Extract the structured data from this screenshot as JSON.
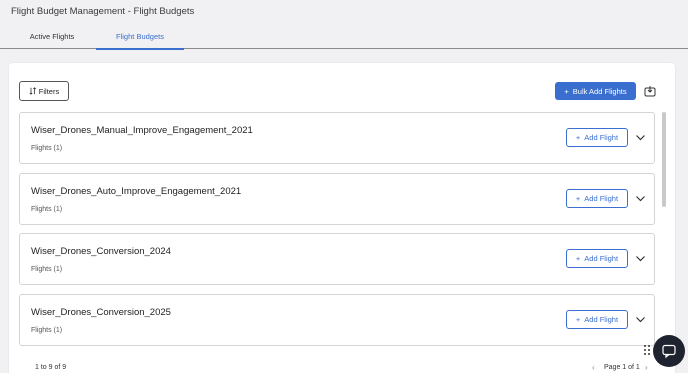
{
  "app": {
    "title": "Flight Budget Management - Flight Budgets"
  },
  "tabs": [
    {
      "label": "Active Flights",
      "active": false
    },
    {
      "label": "Flight Budgets",
      "active": true
    }
  ],
  "toolbar": {
    "filters_label": "Filters",
    "bulk_add_label": "Bulk Add Flights",
    "download_icon": "download-icon"
  },
  "budgets": [
    {
      "name": "Wiser_Drones_Manual_Improve_Engagement_2021",
      "flights": "Flights (1)",
      "add_label": "Add Flight"
    },
    {
      "name": "Wiser_Drones_Auto_Improve_Engagement_2021",
      "flights": "Flights (1)",
      "add_label": "Add Flight"
    },
    {
      "name": "Wiser_Drones_Conversion_2024",
      "flights": "Flights (1)",
      "add_label": "Add Flight"
    },
    {
      "name": "Wiser_Drones_Conversion_2025",
      "flights": "Flights (1)",
      "add_label": "Add Flight"
    }
  ],
  "pagination": {
    "count_text": "1 to 9 of 9",
    "page_text": "Page 1 of 1"
  },
  "colors": {
    "accent": "#3a6fd0",
    "chat_bg": "#1f2330"
  }
}
